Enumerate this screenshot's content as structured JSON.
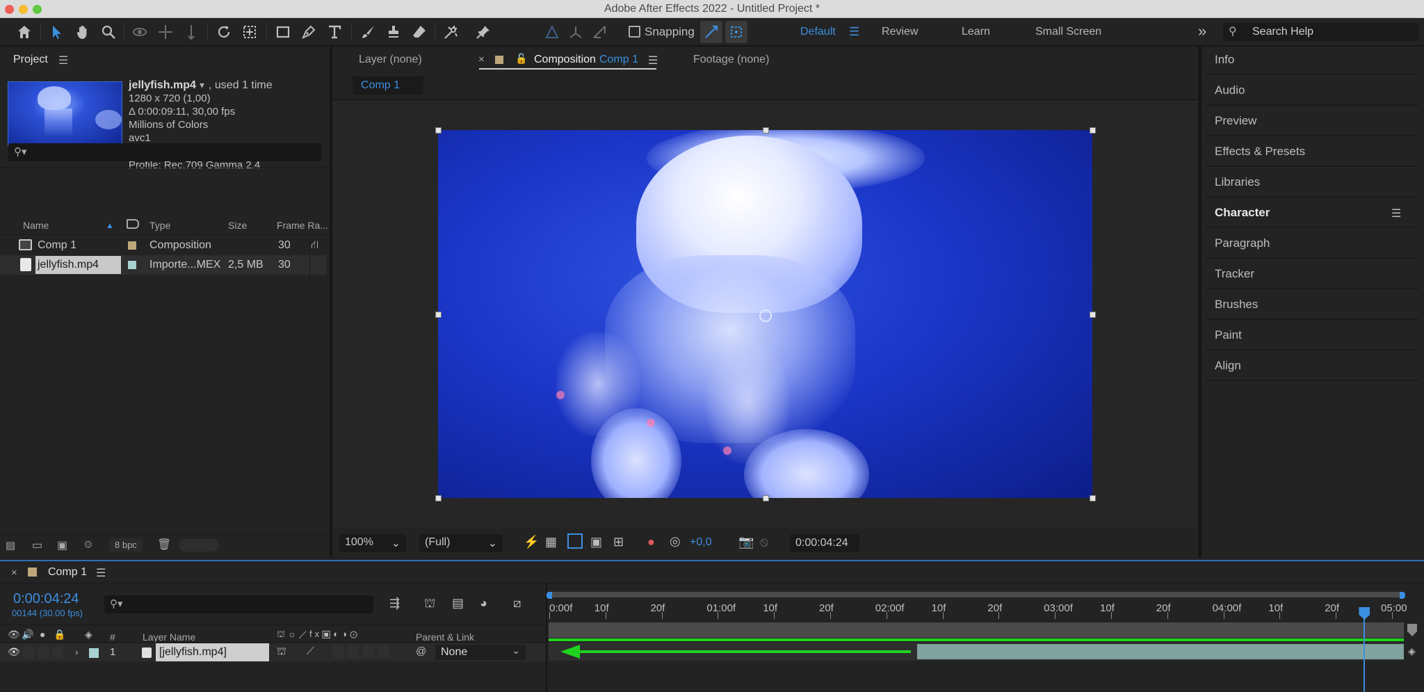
{
  "window": {
    "title": "Adobe After Effects 2022 - Untitled Project *"
  },
  "toolbar": {
    "snapping_label": "Snapping",
    "workspaces": [
      "Default",
      "Review",
      "Learn",
      "Small Screen"
    ],
    "search_placeholder": "Search Help"
  },
  "project": {
    "header": "Project",
    "footage_name": "jellyfish.mp4",
    "used_text": ", used 1 time",
    "info_lines": [
      "1280 x 720 (1,00)",
      "Δ 0:00:09:11, 30,00 fps",
      "Millions of Colors",
      "avc1"
    ],
    "profile": "Profile: Rec.709 Gamma 2.4",
    "columns": [
      "Name",
      "Type",
      "Size",
      "Frame Ra..."
    ],
    "items": [
      {
        "name": "Comp 1",
        "type": "Composition",
        "size": "",
        "frame_rate": "30",
        "label_color": "#bca67a"
      },
      {
        "name": "jellyfish.mp4",
        "type": "Importe...MEX",
        "size": "2,5 MB",
        "frame_rate": "30",
        "label_color": "#a6d2d2"
      }
    ],
    "bpc": "8 bpc"
  },
  "viewer": {
    "tab_layer": "Layer (none)",
    "tab_composition_prefix": "Composition",
    "tab_composition_name": "Comp 1",
    "tab_footage": "Footage (none)",
    "breadcrumb": "Comp 1",
    "zoom": "100%",
    "resolution": "(Full)",
    "exposure": "+0,0",
    "timecode": "0:00:04:24"
  },
  "right_panel": {
    "items": [
      "Info",
      "Audio",
      "Preview",
      "Effects & Presets",
      "Libraries",
      "Character",
      "Paragraph",
      "Tracker",
      "Brushes",
      "Paint",
      "Align"
    ]
  },
  "timeline": {
    "comp_name": "Comp 1",
    "timecode": "0:00:04:24",
    "frame_info": "00144 (30.00 fps)",
    "columns": {
      "num": "#",
      "layer_name": "Layer Name",
      "parent": "Parent & Link"
    },
    "ruler_labels": [
      "0:00f",
      "10f",
      "20f",
      "01:00f",
      "10f",
      "20f",
      "02:00f",
      "10f",
      "20f",
      "03:00f",
      "10f",
      "20f",
      "04:00f",
      "10f",
      "20f",
      "05:00"
    ],
    "layers": [
      {
        "index": "1",
        "name": "[jellyfish.mp4]",
        "parent": "None"
      }
    ],
    "playhead_fraction": 0.954,
    "layer_in_fraction": 0.431
  },
  "colors": {
    "accent": "#3b8fe0",
    "arrow": "#1fd31f",
    "layer_bar": "#8fb7b1"
  }
}
